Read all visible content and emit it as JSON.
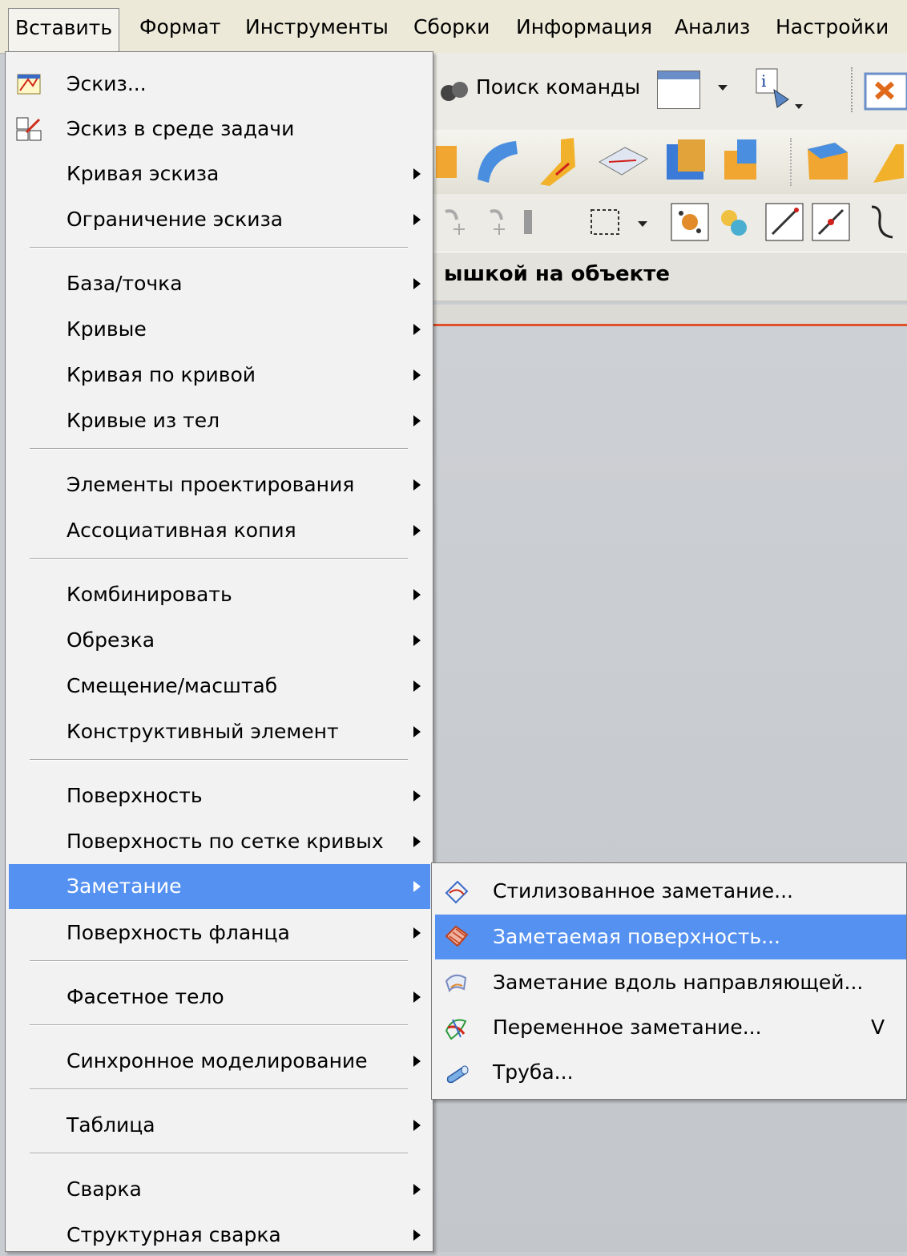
{
  "menubar": {
    "items": [
      "Вставить",
      "Формат",
      "Инструменты",
      "Сборки",
      "Информация",
      "Анализ",
      "Настройки"
    ]
  },
  "toolbar": {
    "command_search_label": "Поиск команды",
    "selection_bar_text": "ышкой на объекте"
  },
  "menu": {
    "items": [
      {
        "label": "Эскиз...",
        "icon": "sketch-icon"
      },
      {
        "label": "Эскиз в среде задачи",
        "icon": "task-sketch-icon"
      },
      {
        "label": "Кривая эскиза"
      },
      {
        "label": "Ограничение эскиза"
      },
      {
        "label": "База/точка"
      },
      {
        "label": "Кривые"
      },
      {
        "label": "Кривая по кривой"
      },
      {
        "label": "Кривые из тел"
      },
      {
        "label": "Элементы проектирования"
      },
      {
        "label": "Ассоциативная копия"
      },
      {
        "label": "Комбинировать"
      },
      {
        "label": "Обрезка"
      },
      {
        "label": "Смещение/масштаб"
      },
      {
        "label": "Конструктивный элемент"
      },
      {
        "label": "Поверхность"
      },
      {
        "label": "Поверхность по сетке кривых"
      },
      {
        "label": "Заметание"
      },
      {
        "label": "Поверхность фланца"
      },
      {
        "label": "Фасетное тело"
      },
      {
        "label": "Синхронное моделирование"
      },
      {
        "label": "Таблица"
      },
      {
        "label": "Сварка"
      },
      {
        "label": "Структурная сварка"
      }
    ]
  },
  "submenu": {
    "items": [
      {
        "label": "Стилизованное заметание...",
        "icon": "styled-sweep-icon"
      },
      {
        "label": "Заметаемая поверхность...",
        "icon": "swept-surface-icon"
      },
      {
        "label": "Заметание вдоль направляющей...",
        "icon": "sweep-along-guide-icon"
      },
      {
        "label": "Переменное заметание...",
        "icon": "variational-sweep-icon",
        "shortcut": "V"
      },
      {
        "label": "Труба...",
        "icon": "tube-icon"
      }
    ]
  },
  "colors": {
    "highlight": "#5591f0",
    "menu_bg": "#f2f2f2",
    "menubar_bg": "#ece9d8",
    "accent_line": "#e0502a"
  }
}
